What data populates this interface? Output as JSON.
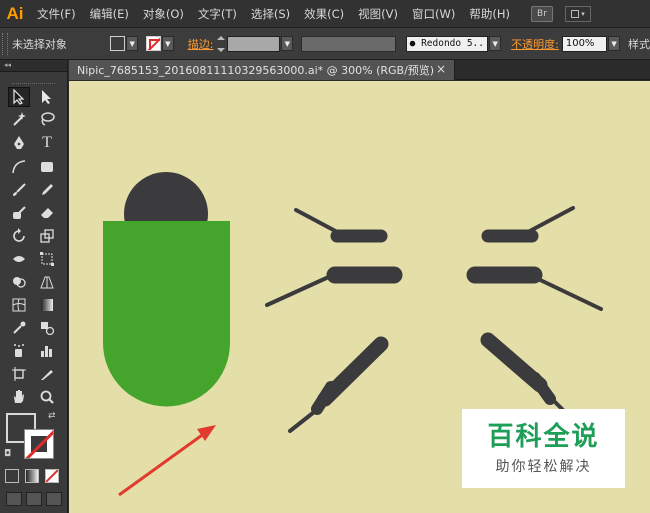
{
  "app": {
    "logo_text": "Ai"
  },
  "menu": {
    "items": [
      "文件(F)",
      "编辑(E)",
      "对象(O)",
      "文字(T)",
      "选择(S)",
      "效果(C)",
      "视图(V)",
      "窗口(W)",
      "帮助(H)"
    ],
    "bridge_badge": "Br"
  },
  "control": {
    "selection_status": "未选择对象",
    "stroke_label": "描边:",
    "brush_value": "● Redondo 5..",
    "opacity_label": "不透明度:",
    "opacity_value": "100%",
    "style_label": "样式"
  },
  "tools": {
    "panel_header": "◂◂"
  },
  "document": {
    "tab_title": "Nipic_7685153_20160811110329563000.ai* @ 300% (RGB/预览)",
    "close_glyph": "×"
  },
  "colors": {
    "canvas_bg": "#e4dea8",
    "body_green": "#45a42c",
    "dark_shape": "#3b3a3c",
    "arrow_red": "#e23a2e",
    "accent_orange": "#ff9a00"
  },
  "watermark": {
    "title": "百科全说",
    "subtitle": "助你轻松解决"
  }
}
